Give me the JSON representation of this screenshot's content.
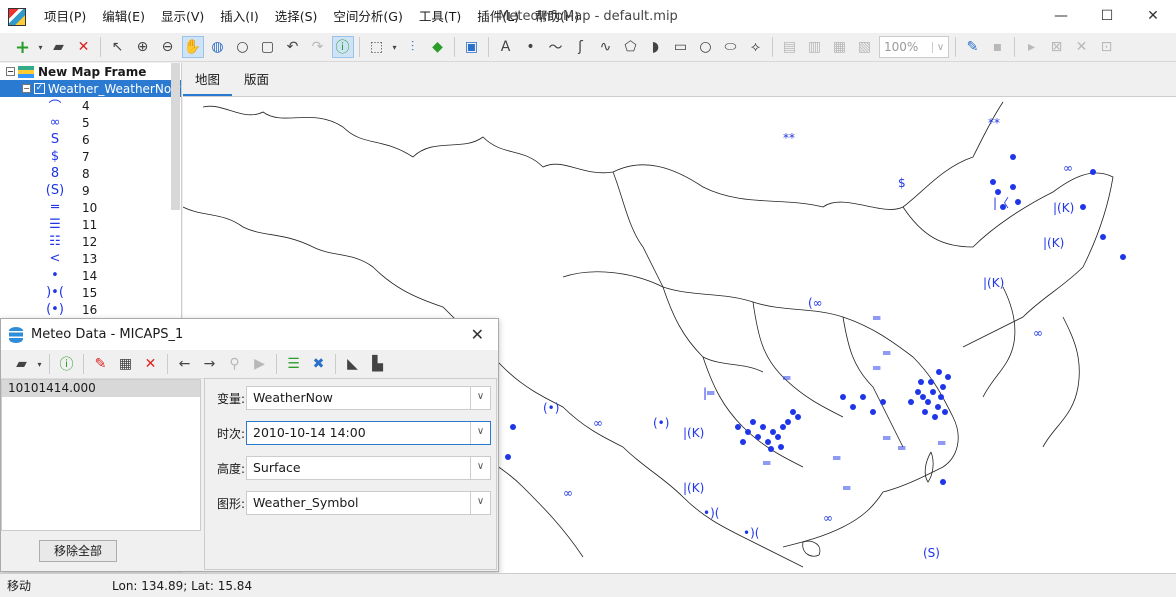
{
  "app": {
    "title": "MeteoInfoMap - default.mip",
    "menu": [
      "项目(P)",
      "编辑(E)",
      "显示(V)",
      "插入(I)",
      "选择(S)",
      "空间分析(G)",
      "工具(T)",
      "插件(L)",
      "帮助(H)"
    ],
    "window_controls": [
      "—",
      "☐",
      "✕"
    ]
  },
  "toolbar": {
    "zoom_value": "100%"
  },
  "layer_tree": {
    "frame_label": "New Map Frame",
    "layer_label": "Weather_WeatherNow",
    "legend": [
      {
        "symbol": "⌒",
        "label": "4"
      },
      {
        "symbol": "∞",
        "label": "5"
      },
      {
        "symbol": "S",
        "label": "6"
      },
      {
        "symbol": "$",
        "label": "7"
      },
      {
        "symbol": "8",
        "label": "8"
      },
      {
        "symbol": "(S)",
        "label": "9"
      },
      {
        "symbol": "═",
        "label": "10"
      },
      {
        "symbol": "☰",
        "label": "11"
      },
      {
        "symbol": "☷",
        "label": "12"
      },
      {
        "symbol": "<",
        "label": "13"
      },
      {
        "symbol": "•",
        "label": "14"
      },
      {
        "symbol": ")•(",
        "label": "15"
      },
      {
        "symbol": "(•)",
        "label": "16"
      }
    ]
  },
  "map_tabs": [
    "地图",
    "版面"
  ],
  "dialog": {
    "title": "Meteo Data - MICAPS_1",
    "file_item": "10101414.000",
    "remove_all_label": "移除全部",
    "fields": [
      {
        "label": "变量:",
        "value": "WeatherNow"
      },
      {
        "label": "时次:",
        "value": "2010-10-14 14:00"
      },
      {
        "label": "高度:",
        "value": "Surface"
      },
      {
        "label": "图形:",
        "value": "Weather_Symbol"
      }
    ]
  },
  "status": {
    "mode": "移动",
    "coords": "Lon: 134.89; Lat: 15.84"
  }
}
